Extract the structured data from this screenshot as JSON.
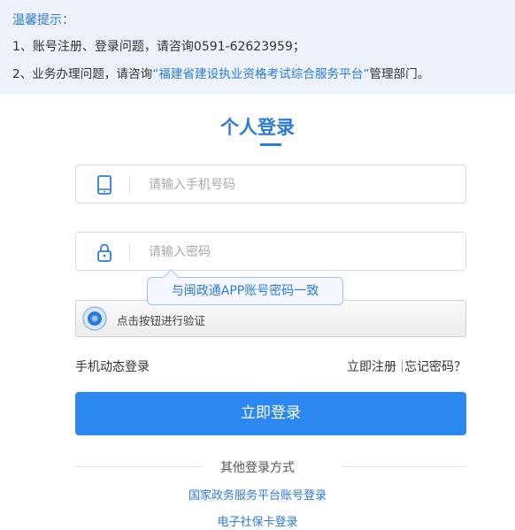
{
  "notice": {
    "title": "温馨提示：",
    "line1": "1、账号注册、登录问题，请咨询0591-62623959；",
    "line2_prefix": "2、业务办理问题，请咨询",
    "line2_platform": "“福建省建设执业资格考试综合服务平台”",
    "line2_suffix": "管理部门。"
  },
  "login": {
    "title": "个人登录",
    "phone_placeholder": "请输入手机号码",
    "password_placeholder": "请输入密码",
    "tooltip": "与闽政通APP账号密码一致",
    "verify_text": "点击按钮进行验证",
    "sms_login": "手机动态登录",
    "register": "立即注册",
    "forgot": "忘记密码？",
    "submit": "立即登录"
  },
  "other": {
    "title": "其他登录方式",
    "links": [
      "国家政务服务平台账号登录",
      "电子社保卡登录"
    ]
  },
  "colors": {
    "accent": "#2b7bdc",
    "button": "#2b88f0",
    "notice_bg": "#eef3fb"
  },
  "icons": [
    "phone-icon",
    "lock-icon",
    "verify-knob-icon"
  ]
}
